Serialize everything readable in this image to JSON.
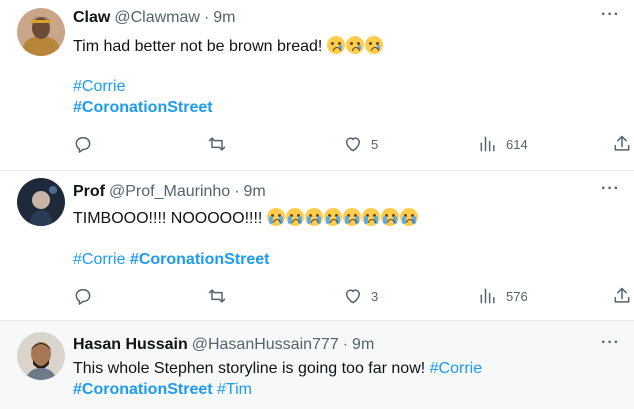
{
  "tweets": [
    {
      "name": "Claw",
      "handle": "@Clawmaw",
      "dot": "·",
      "time": "9m",
      "text": "Tim had better not be brown bread!",
      "hashtags": [
        "#Corrie",
        "#CoronationStreet"
      ],
      "replies": "",
      "retweets": "",
      "likes": "5",
      "views": "614"
    },
    {
      "name": "Prof",
      "handle": "@Prof_Maurinho",
      "dot": "·",
      "time": "9m",
      "text": "TIMBOOO!!!! NOOOOO!!!!",
      "hashtags": [
        "#Corrie",
        "#CoronationStreet"
      ],
      "replies": "",
      "retweets": "",
      "likes": "3",
      "views": "576"
    },
    {
      "name": "Hasan Hussain",
      "handle": "@HasanHussain777",
      "dot": "·",
      "time": "9m",
      "text": "This whole Stephen storyline is going too far now!",
      "hashtags": [
        "#Corrie",
        "#CoronationStreet",
        "#Tim"
      ]
    }
  ],
  "icons": {
    "reply": "reply-icon",
    "retweet": "retweet-icon",
    "like": "heart-icon",
    "views": "views-icon",
    "share": "share-icon",
    "more": "more-icon"
  },
  "colors": {
    "link": "#1d9bf0",
    "muted": "#536471",
    "text": "#0f1419"
  }
}
